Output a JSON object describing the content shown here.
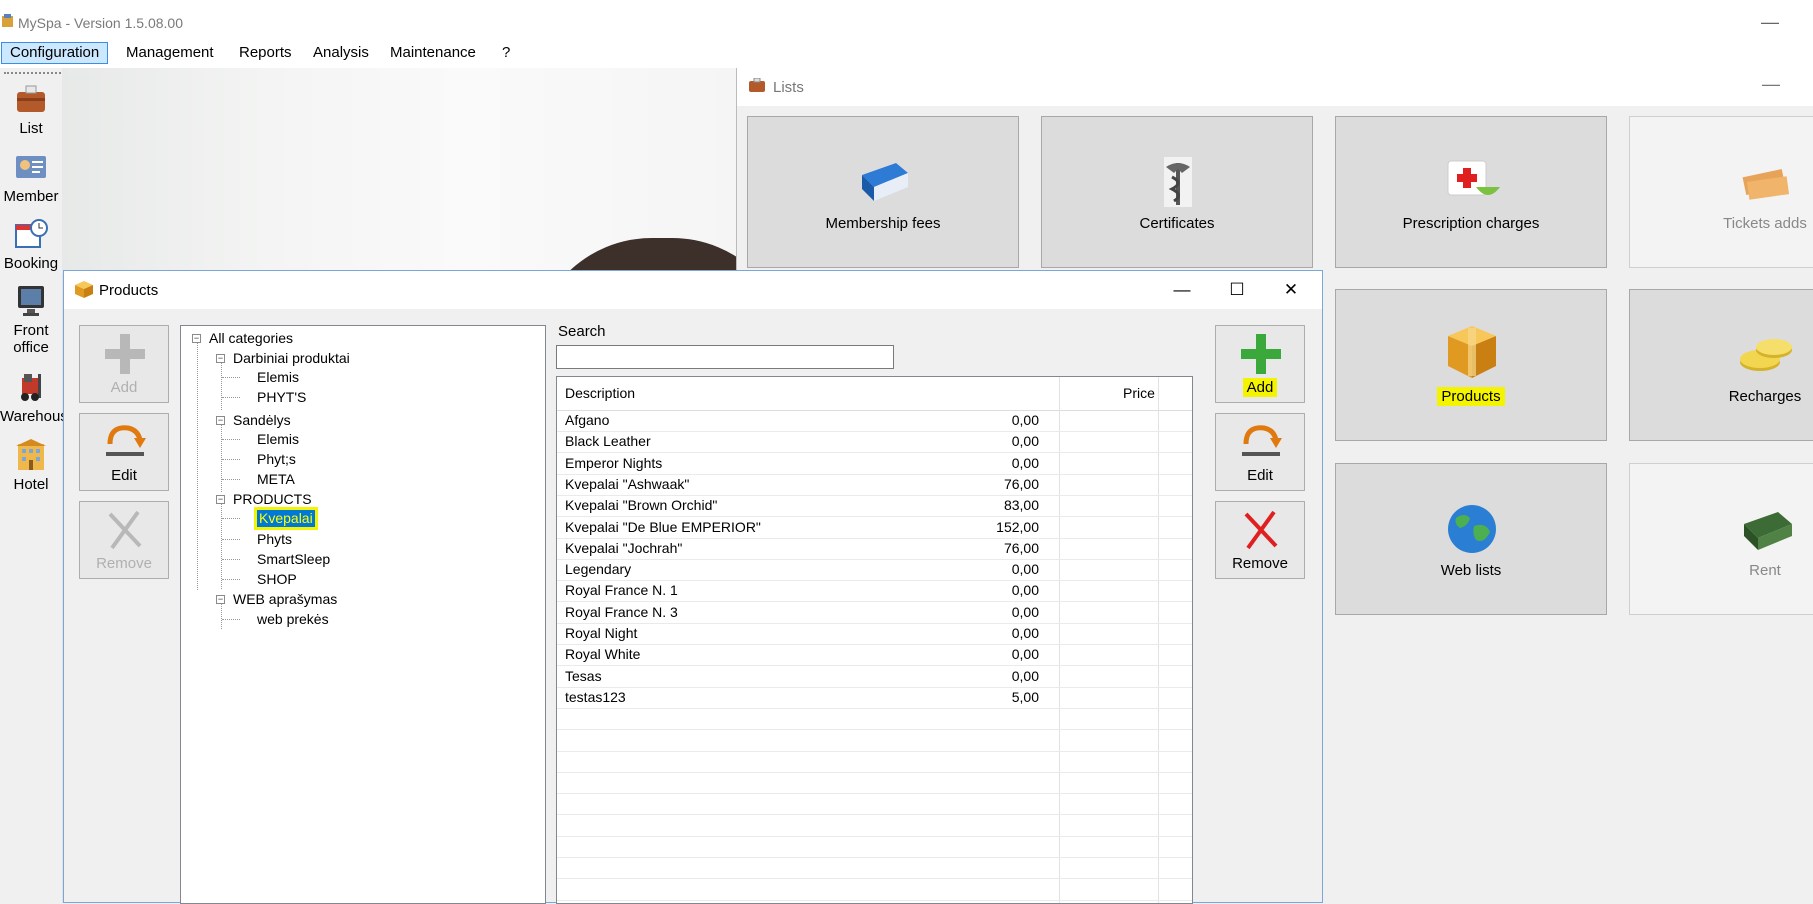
{
  "app": {
    "title": "MySpa - Version 1.5.08.00",
    "minimize": "—"
  },
  "menu": {
    "items": [
      "Configuration",
      "Management",
      "Reports",
      "Analysis",
      "Maintenance",
      "?"
    ]
  },
  "toolbar": {
    "list": "List",
    "member": "Member",
    "booking": "Booking",
    "front_office_1": "Front",
    "front_office_2": "office",
    "warehouse": "Warehous",
    "hotel": "Hotel"
  },
  "lists_window": {
    "title": "Lists",
    "minimize": "—",
    "tiles": {
      "membership_fees": "Membership fees",
      "certificates": "Certificates",
      "prescription_charges": "Prescription charges",
      "tickets_adds": "Tickets adds",
      "products": "Products",
      "recharges": "Recharges",
      "web_lists": "Web lists",
      "rent": "Rent"
    }
  },
  "products_window": {
    "title": "Products",
    "controls": {
      "minimize": "—",
      "maximize": "☐",
      "close": "✕"
    },
    "left_buttons": {
      "add": "Add",
      "edit": "Edit",
      "remove": "Remove"
    },
    "right_buttons": {
      "add": "Add",
      "edit": "Edit",
      "remove": "Remove"
    },
    "tree": {
      "root": "All categories",
      "darbiniai": "Darbiniai produktai",
      "darbiniai_elemis": "Elemis",
      "darbiniai_phyts": "PHYT'S",
      "sandelys": "Sandėlys",
      "sandelys_elemis": "Elemis",
      "sandelys_phyts": "Phyt;s",
      "sandelys_meta": "META",
      "products": "PRODUCTS",
      "products_kvepalai": "Kvepalai",
      "products_phyts": "Phyts",
      "products_smartsleep": "SmartSleep",
      "products_shop": "SHOP",
      "web": "WEB aprašymas",
      "web_prekes": "web prekės"
    },
    "search": {
      "label": "Search",
      "value": ""
    },
    "grid": {
      "headers": {
        "description": "Description",
        "price": "Price"
      },
      "rows": [
        {
          "description": "Afgano",
          "price": "0,00"
        },
        {
          "description": "Black Leather",
          "price": "0,00"
        },
        {
          "description": "Emperor Nights",
          "price": "0,00"
        },
        {
          "description": "Kvepalai \"Ashwaak\"",
          "price": "76,00"
        },
        {
          "description": "Kvepalai \"Brown Orchid\"",
          "price": "83,00"
        },
        {
          "description": "Kvepalai \"De Blue EMPERIOR\"",
          "price": "152,00"
        },
        {
          "description": "Kvepalai \"Jochrah\"",
          "price": "76,00"
        },
        {
          "description": "Legendary",
          "price": "0,00"
        },
        {
          "description": "Royal France N. 1",
          "price": "0,00"
        },
        {
          "description": "Royal France N. 3",
          "price": "0,00"
        },
        {
          "description": "Royal Night",
          "price": "0,00"
        },
        {
          "description": "Royal White",
          "price": "0,00"
        },
        {
          "description": "Tesas",
          "price": "0,00"
        },
        {
          "description": "testas123",
          "price": "5,00"
        }
      ]
    }
  },
  "colors": {
    "highlight": "#f4f400",
    "selection": "#0078d7",
    "menu_active": "#cce8ff"
  }
}
